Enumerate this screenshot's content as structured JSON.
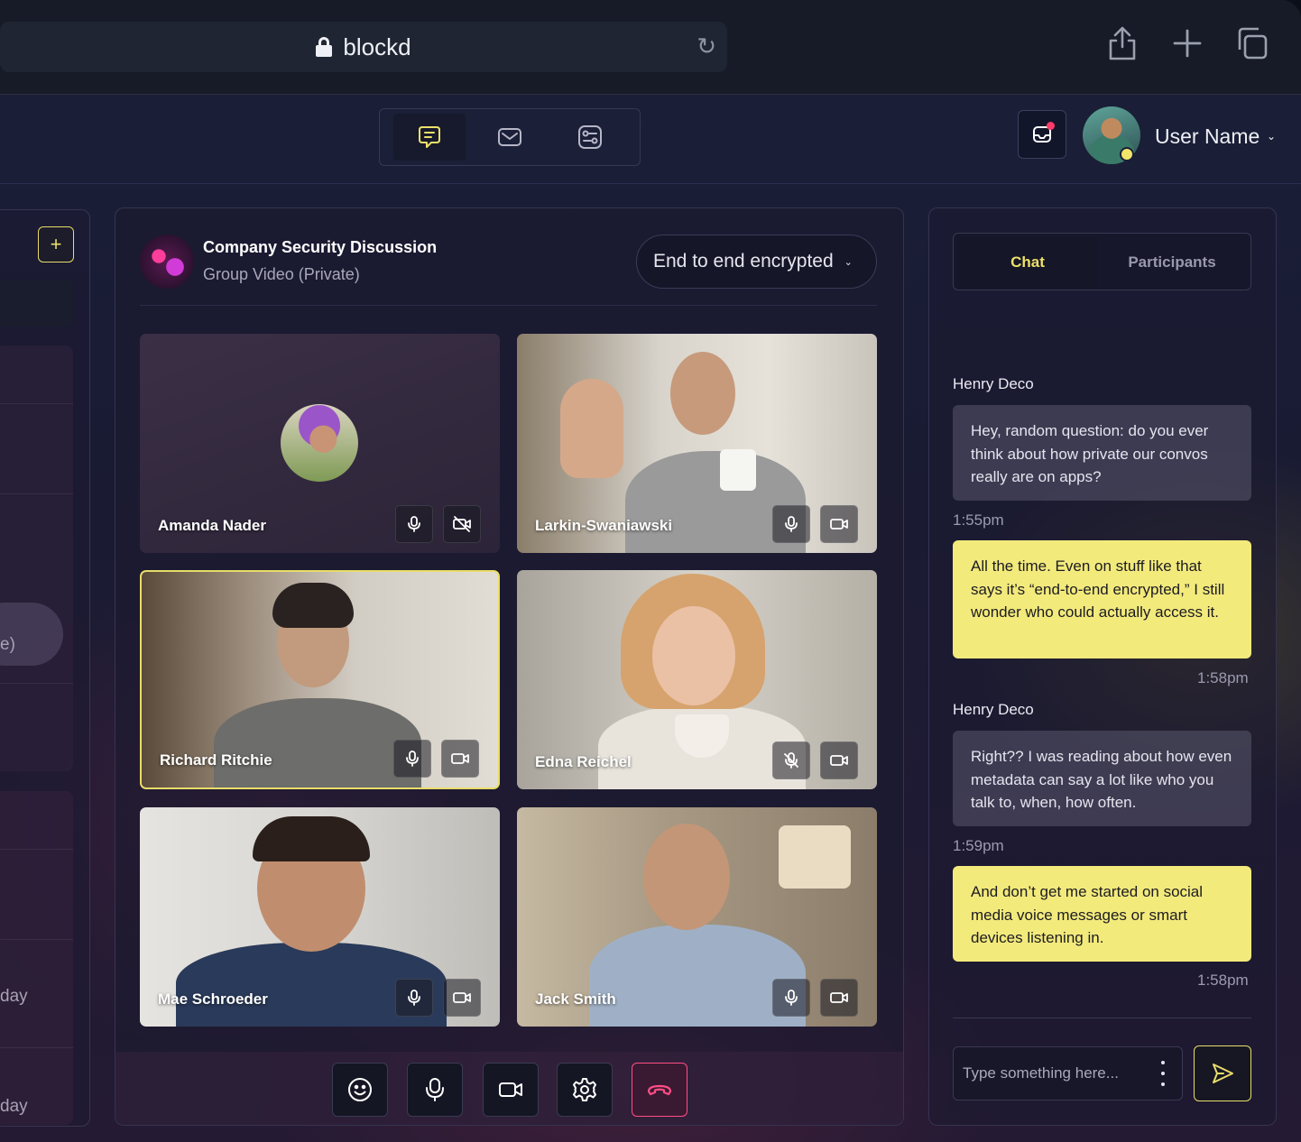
{
  "browser": {
    "url": "blockd",
    "icons": [
      "lock-icon",
      "reload-icon",
      "share-icon",
      "new-tab-icon",
      "tabs-icon"
    ]
  },
  "header": {
    "nav_tabs": [
      {
        "icon": "chat-icon",
        "active": true
      },
      {
        "icon": "mail-icon",
        "active": false
      },
      {
        "icon": "settings-list-icon",
        "active": false
      }
    ],
    "user_name": "User Name",
    "user_caret": "⌄",
    "colors": {
      "accent": "#ece06a",
      "notification": "#ff3b6a"
    }
  },
  "left_panel": {
    "add_label": "+",
    "fragments": [
      "e)",
      "day",
      "day"
    ]
  },
  "conversation": {
    "title": "Company Security Discussion",
    "subtitle": "Group Video (Private)",
    "encryption": "End to end encrypted",
    "encryption_caret": "⌄"
  },
  "participants": [
    {
      "name": "Amanda Nader",
      "mic": "on",
      "camera": "off"
    },
    {
      "name": "Larkin-Swaniawski",
      "mic": "on",
      "camera": "on"
    },
    {
      "name": "Richard Ritchie",
      "mic": "on",
      "camera": "on",
      "speaking": true
    },
    {
      "name": "Edna Reichel",
      "mic": "muted",
      "camera": "on"
    },
    {
      "name": "Mae Schroeder",
      "mic": "on",
      "camera": "on"
    },
    {
      "name": "Jack Smith",
      "mic": "on",
      "camera": "on"
    }
  ],
  "toolbar": {
    "buttons": [
      "emoji-icon",
      "microphone-icon",
      "video-camera-icon",
      "gear-icon",
      "end-call-icon"
    ]
  },
  "chat": {
    "tabs": [
      {
        "label": "Chat",
        "active": true
      },
      {
        "label": "Participants",
        "active": false
      }
    ],
    "messages": [
      {
        "sender": "Henry Deco",
        "text": "Hey, random question: do you ever think about how private our convos really are on apps?",
        "time": "1:55pm",
        "direction": "in"
      },
      {
        "sender": "",
        "text": "All the time. Even on stuff like that says it’s “end-to-end encrypted,” I still wonder who could actually access it.",
        "time": "1:58pm",
        "direction": "out"
      },
      {
        "sender": "Henry Deco",
        "text": "Right?? I was reading about how even metadata can say a lot like who you talk to, when, how often.",
        "time": "1:59pm",
        "direction": "in"
      },
      {
        "sender": "",
        "text": "And don’t get me started on social media voice messages or smart devices listening in.",
        "time": "1:58pm",
        "direction": "out"
      }
    ],
    "input_placeholder": "Type something here..."
  }
}
